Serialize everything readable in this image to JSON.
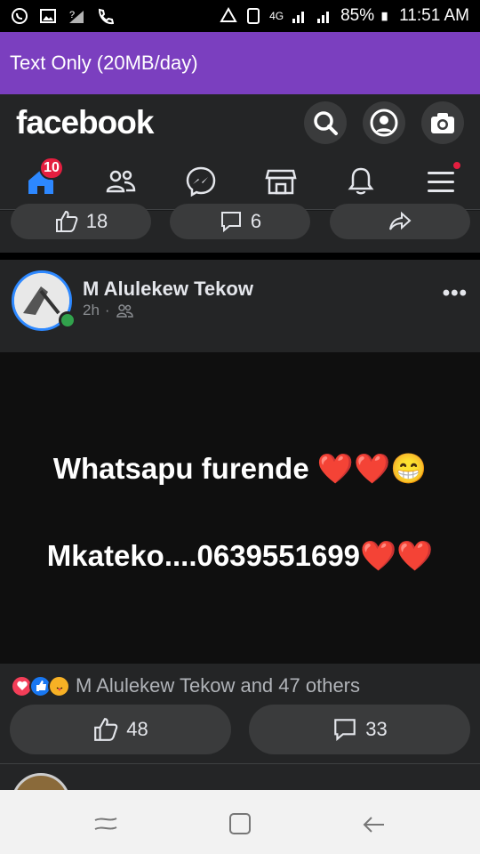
{
  "status": {
    "time": "11:51 AM",
    "battery": "85%",
    "network": "4G"
  },
  "banner": {
    "text": "Text Only (20MB/day)"
  },
  "header": {
    "logo": "facebook"
  },
  "nav": {
    "home_badge": "10"
  },
  "prev_post": {
    "likes": "18",
    "comments": "6"
  },
  "post": {
    "author": "M Alulekew Tekow",
    "time": "2h",
    "dot": "·",
    "line1": "Whatsapu furende ❤️❤️😁",
    "line2": "Mkateko....0639551699❤️❤️",
    "reactions_text": "M Alulekew Tekow and 47 others",
    "likes": "48",
    "comments": "33"
  },
  "colors": {
    "brand": "#2d88ff",
    "banner": "#7b3fbf",
    "badge": "#e41e3f"
  }
}
